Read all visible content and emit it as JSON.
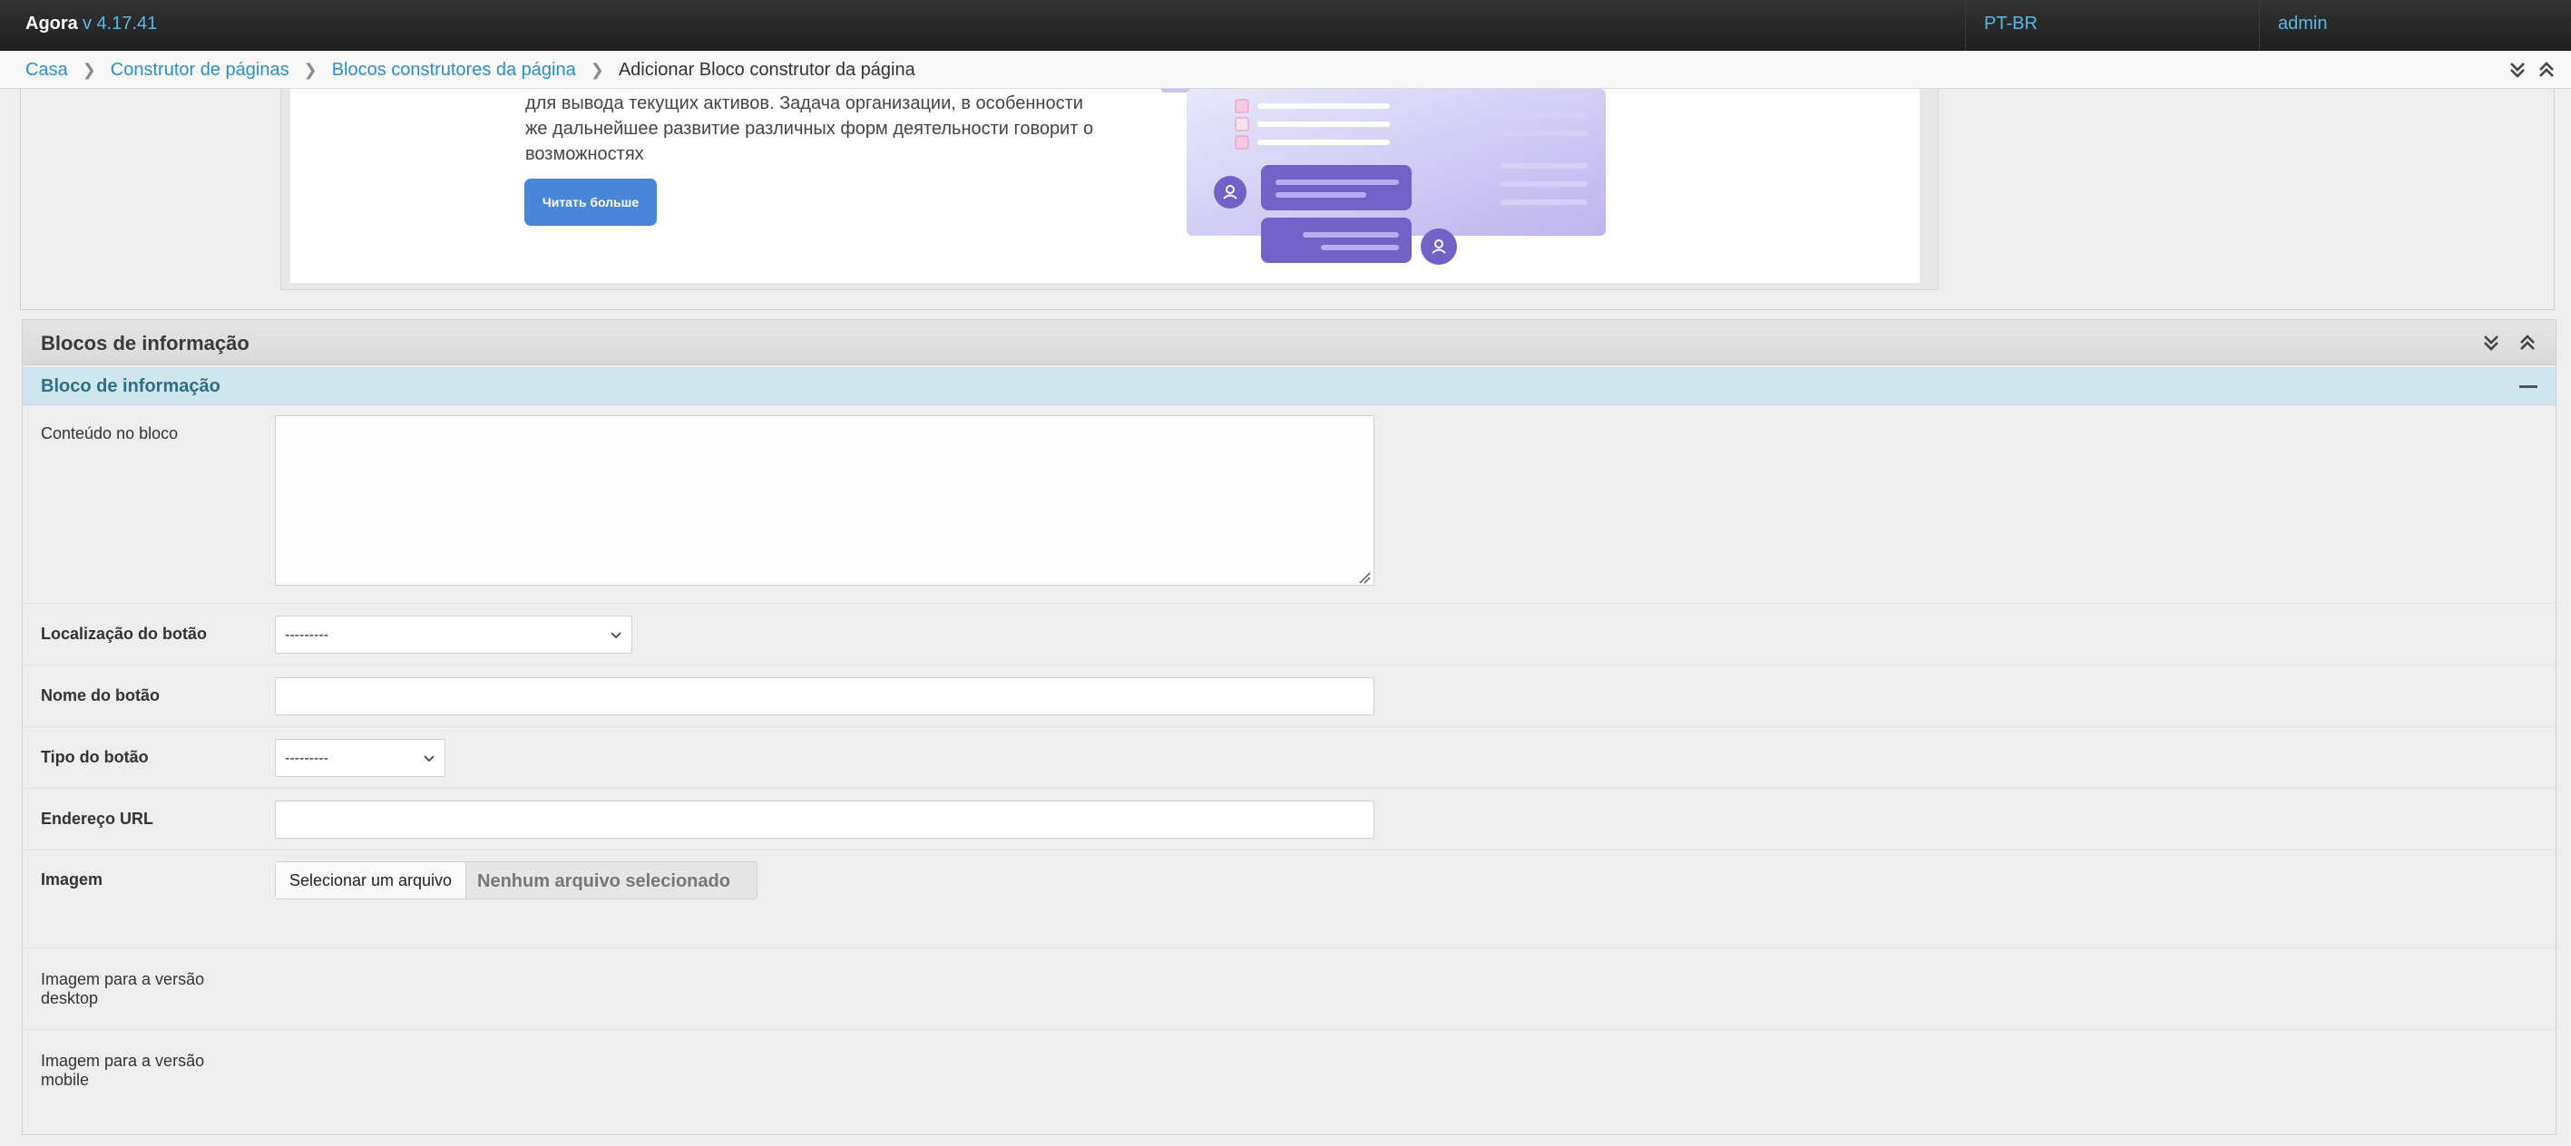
{
  "header": {
    "brand": "Agora",
    "version": "v 4.17.41",
    "language": "PT-BR",
    "user": "admin"
  },
  "breadcrumb": {
    "items": [
      "Casa",
      "Construtor de páginas",
      "Blocos construtores da página"
    ],
    "current": "Adicionar Bloco construtor da página"
  },
  "preview": {
    "text_line_1": "для вывода текущих активов. Задача организации, в особенности",
    "text_line_2": "же дальнейшее развитие различных форм деятельности говорит о",
    "text_line_3": "возможностях",
    "button_label": "Читать больше",
    "accent_color": "#4a86d8",
    "illustration_color": "#6c5fc4"
  },
  "info_blocks": {
    "panel_title": "Blocos de informação",
    "block_title": "Bloco de informação",
    "fields": {
      "content_label": "Conteúdo no bloco",
      "content_value": "",
      "button_location_label": "Localização do botão",
      "button_location_value": "---------",
      "button_name_label": "Nome do botão",
      "button_name_value": "",
      "button_type_label": "Tipo do botão",
      "button_type_value": "---------",
      "url_label": "Endereço URL",
      "url_value": "",
      "image_label": "Imagem",
      "file_button_label": "Selecionar um arquivo",
      "file_none_label": "Nenhum arquivo selecionado",
      "desktop_image_label_1": "Imagem para a versão",
      "desktop_image_label_2": "desktop",
      "mobile_image_label_1": "Imagem para a versão",
      "mobile_image_label_2": "mobile"
    }
  },
  "colors": {
    "header_bg": "#2a2a2a",
    "link": "#2b8fc3",
    "version": "#5bb7e8",
    "sub_header_bg": "#cfe6ef"
  }
}
